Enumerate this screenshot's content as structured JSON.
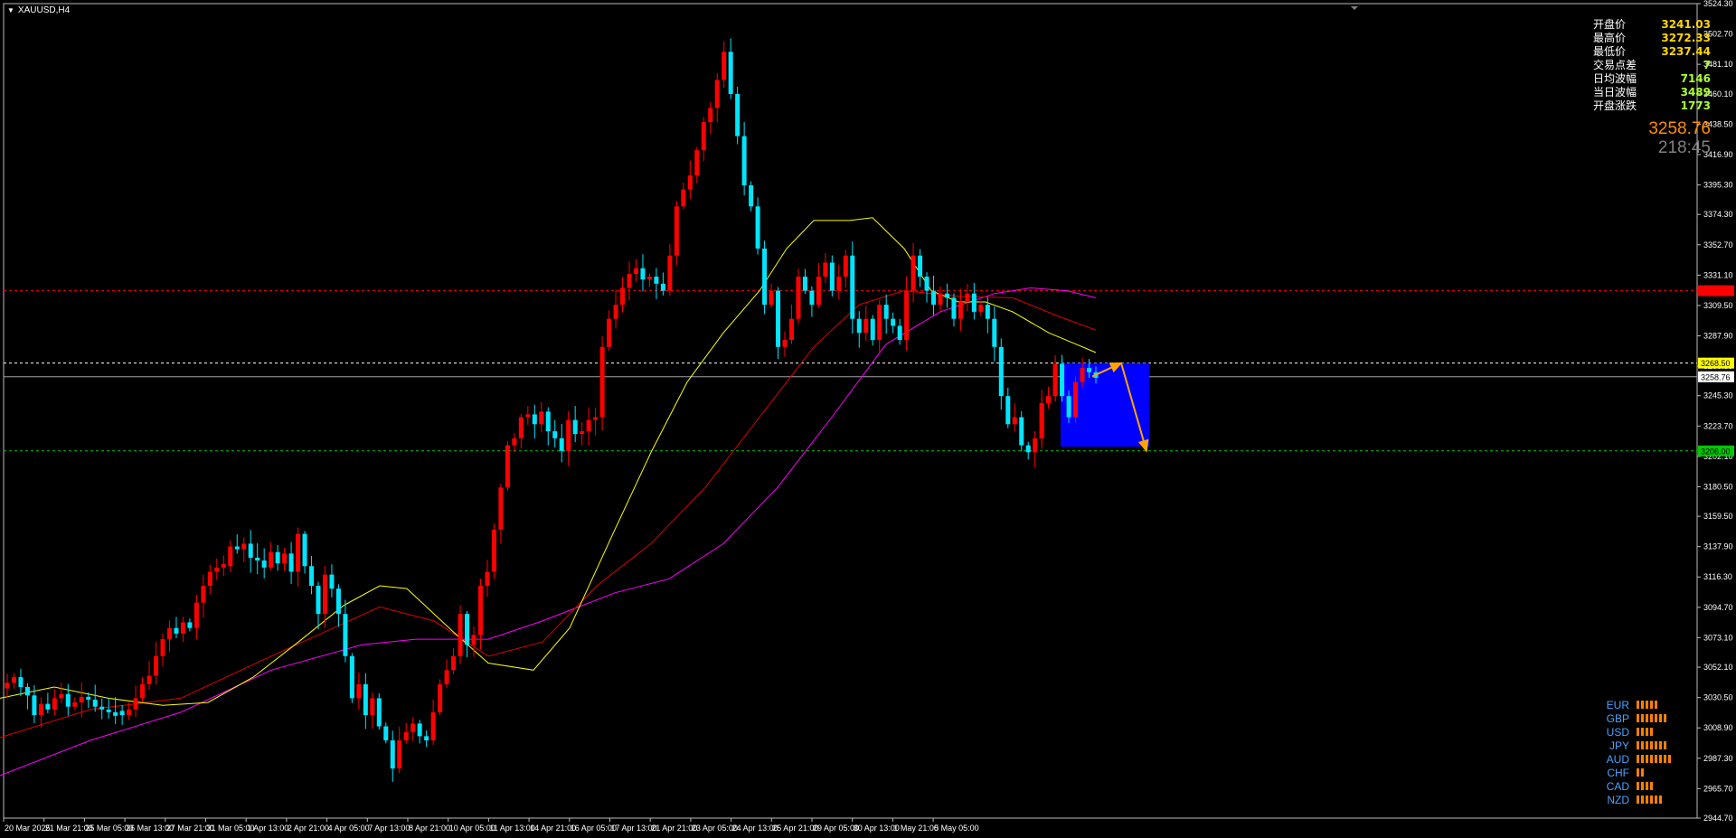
{
  "symbol": "XAUUSD,H4",
  "info_panel": [
    {
      "label": "开盘价",
      "value": "3241.03"
    },
    {
      "label": "最高价",
      "value": "3272.33"
    },
    {
      "label": "最低价",
      "value": "3237.44"
    },
    {
      "label": "交易点差",
      "value": "7"
    },
    {
      "label": "日均波幅",
      "value": "7146"
    },
    {
      "label": "当日波幅",
      "value": "3489"
    },
    {
      "label": "开盘涨跌",
      "value": "1773"
    }
  ],
  "current_price": "3258.76",
  "timer": "218:45",
  "price_axis_labels": [
    "3524.30",
    "3502.70",
    "3481.10",
    "3460.10",
    "3438.50",
    "3416.90",
    "3395.30",
    "3374.30",
    "3352.70",
    "3331.10",
    "3309.50",
    "3287.90",
    "3266.30",
    "3245.30",
    "3223.70",
    "3202.10",
    "3180.50",
    "3159.50",
    "3137.90",
    "3116.30",
    "3094.70",
    "3073.10",
    "3052.10",
    "3030.50",
    "3008.90",
    "2987.30",
    "2965.70",
    "2944.70"
  ],
  "time_axis_labels": [
    "20 Mar 2025",
    "21 Mar 21:00",
    "25 Mar 05:00",
    "26 Mar 13:00",
    "27 Mar 21:00",
    "31 Mar 05:00",
    "1 Apr 13:00",
    "2 Apr 21:00",
    "4 Apr 05:00",
    "7 Apr 13:00",
    "8 Apr 21:00",
    "10 Apr 05:00",
    "11 Apr 13:00",
    "14 Apr 21:00",
    "16 Apr 05:00",
    "17 Apr 13:00",
    "21 Apr 21:00",
    "23 Apr 05:00",
    "24 Apr 13:00",
    "25 Apr 21:00",
    "29 Apr 05:00",
    "30 Apr 13:00",
    "1 May 21:00",
    "5 May 05:00"
  ],
  "level_tags": [
    {
      "value": 3320.0,
      "text": "3320.00",
      "color": "#ff0000",
      "text_color": "#ff0000",
      "line_color": "#ff0000"
    },
    {
      "value": 3268.5,
      "text": "3268.50",
      "color": "#ffff00",
      "text_color": "#000000",
      "line_color": "#ffffff"
    },
    {
      "value": 3258.76,
      "text": "3258.76",
      "color": "#ffffff",
      "text_color": "#000000",
      "line_color": "#a0a0a0"
    },
    {
      "value": 3206.0,
      "text": "3206.00",
      "color": "#00c800",
      "text_color": "#000000",
      "line_color": "#00c800"
    }
  ],
  "currency_strength": [
    {
      "name": "EUR",
      "bars": 5
    },
    {
      "name": "GBP",
      "bars": 7
    },
    {
      "name": "USD",
      "bars": 4
    },
    {
      "name": "JPY",
      "bars": 7
    },
    {
      "name": "AUD",
      "bars": 8
    },
    {
      "name": "CHF",
      "bars": 2
    },
    {
      "name": "CAD",
      "bars": 4
    },
    {
      "name": "NZD",
      "bars": 6
    }
  ],
  "colors": {
    "up_candle": "#ff0000",
    "down_candle": "#00e5ff",
    "ma_fast": "#ffff00",
    "ma_mid": "#dd0000",
    "ma_slow": "#ff00ff",
    "box": "#0000ff",
    "arrow": "#ffa500"
  },
  "chart_data": {
    "type": "candlestick",
    "ylim": [
      2944.7,
      3524.3
    ],
    "y_ticks": [
      3524.3,
      3502.7,
      3481.1,
      3460.1,
      3438.5,
      3416.9,
      3395.3,
      3374.3,
      3352.7,
      3331.1,
      3309.5,
      3287.9,
      3266.3,
      3245.3,
      3223.7,
      3202.1,
      3180.5,
      3159.5,
      3137.9,
      3116.3,
      3094.7,
      3073.1,
      3052.1,
      3030.5,
      3008.9,
      2987.3,
      2965.7,
      2944.7
    ],
    "close_path": [
      3041,
      3045,
      3038,
      3032,
      3018,
      3026,
      3022,
      3030,
      3033,
      3024,
      3027,
      3031,
      3029,
      3024,
      3022,
      3020,
      3021,
      3018,
      3022,
      3030,
      3040,
      3046,
      3060,
      3072,
      3080,
      3076,
      3084,
      3080,
      3098,
      3110,
      3120,
      3123,
      3124,
      3138,
      3136,
      3140,
      3130,
      3128,
      3123,
      3134,
      3126,
      3133,
      3120,
      3147,
      3124,
      3110,
      3090,
      3118,
      3108,
      3090,
      3060,
      3030,
      3040,
      3018,
      3030,
      3010,
      3000,
      2980,
      3000,
      3006,
      3012,
      3003,
      3000,
      3020,
      3040,
      3050,
      3060,
      3090,
      3068,
      3075,
      3110,
      3120,
      3150,
      3180,
      3210,
      3215,
      3230,
      3232,
      3225,
      3234,
      3220,
      3215,
      3206,
      3228,
      3218,
      3220,
      3228,
      3230,
      3280,
      3300,
      3310,
      3322,
      3332,
      3336,
      3328,
      3330,
      3325,
      3320,
      3345,
      3380,
      3392,
      3402,
      3420,
      3440,
      3450,
      3470,
      3490,
      3460,
      3430,
      3395,
      3380,
      3350,
      3310,
      3320,
      3280,
      3285,
      3300,
      3330,
      3320,
      3310,
      3330,
      3340,
      3320,
      3330,
      3345,
      3300,
      3290,
      3300,
      3285,
      3310,
      3300,
      3295,
      3285,
      3320,
      3345,
      3330,
      3320,
      3310,
      3318,
      3315,
      3300,
      3312,
      3318,
      3305,
      3310,
      3300,
      3280,
      3245,
      3225,
      3230,
      3210,
      3205,
      3215,
      3240,
      3245,
      3268,
      3245,
      3230,
      3255,
      3265,
      3262,
      3258
    ],
    "ma_fast_path": [
      [
        0,
        3030
      ],
      [
        60,
        3038
      ],
      [
        120,
        3030
      ],
      [
        180,
        3025
      ],
      [
        230,
        3027
      ],
      [
        280,
        3045
      ],
      [
        330,
        3070
      ],
      [
        380,
        3096
      ],
      [
        420,
        3110
      ],
      [
        450,
        3108
      ],
      [
        500,
        3078
      ],
      [
        540,
        3055
      ],
      [
        590,
        3050
      ],
      [
        630,
        3080
      ],
      [
        680,
        3150
      ],
      [
        720,
        3205
      ],
      [
        760,
        3255
      ],
      [
        800,
        3290
      ],
      [
        840,
        3320
      ],
      [
        870,
        3350
      ],
      [
        900,
        3370
      ],
      [
        940,
        3370
      ],
      [
        965,
        3372
      ],
      [
        1000,
        3350
      ],
      [
        1030,
        3320
      ],
      [
        1060,
        3312
      ],
      [
        1090,
        3312
      ],
      [
        1120,
        3305
      ],
      [
        1160,
        3290
      ],
      [
        1190,
        3282
      ],
      [
        1212,
        3276
      ]
    ],
    "ma_mid_path": [
      [
        0,
        3002
      ],
      [
        100,
        3022
      ],
      [
        200,
        3030
      ],
      [
        300,
        3060
      ],
      [
        420,
        3095
      ],
      [
        480,
        3085
      ],
      [
        540,
        3060
      ],
      [
        600,
        3070
      ],
      [
        660,
        3110
      ],
      [
        720,
        3140
      ],
      [
        780,
        3180
      ],
      [
        840,
        3230
      ],
      [
        900,
        3280
      ],
      [
        950,
        3310
      ],
      [
        1000,
        3320
      ],
      [
        1060,
        3316
      ],
      [
        1120,
        3315
      ],
      [
        1170,
        3302
      ],
      [
        1212,
        3292
      ]
    ],
    "ma_slow_path": [
      [
        0,
        2975
      ],
      [
        100,
        3000
      ],
      [
        200,
        3020
      ],
      [
        300,
        3050
      ],
      [
        400,
        3068
      ],
      [
        460,
        3072
      ],
      [
        540,
        3072
      ],
      [
        600,
        3085
      ],
      [
        680,
        3105
      ],
      [
        740,
        3115
      ],
      [
        800,
        3140
      ],
      [
        860,
        3180
      ],
      [
        920,
        3230
      ],
      [
        980,
        3282
      ],
      [
        1040,
        3305
      ],
      [
        1100,
        3318
      ],
      [
        1140,
        3322
      ],
      [
        1180,
        3320
      ],
      [
        1212,
        3315
      ]
    ],
    "box": {
      "x0": 1173,
      "x1": 1271,
      "y_top": 3268.5,
      "y_bottom": 3209
    },
    "arrows": [
      {
        "from": [
          1208,
          3259
        ],
        "to": [
          1240,
          3268.5
        ]
      },
      {
        "from": [
          1240,
          3268.5
        ],
        "to": [
          1268,
          3206
        ]
      }
    ]
  }
}
